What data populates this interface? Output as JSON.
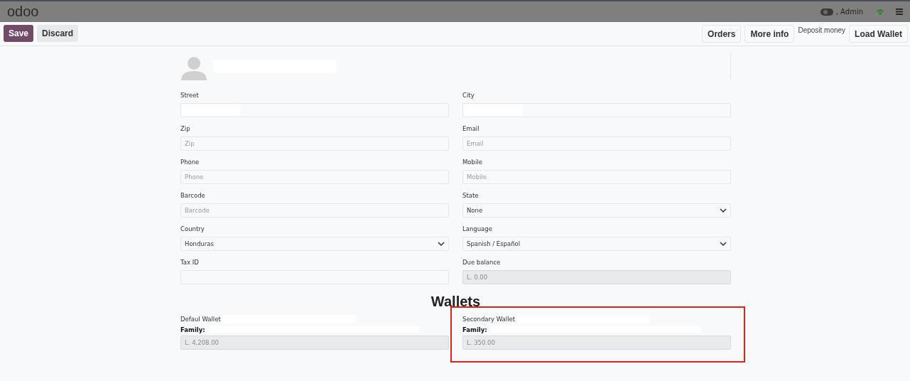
{
  "top_bar": {
    "logo": "odoo",
    "user": ", Admin"
  },
  "toolbar": {
    "left_buttons": [
      {
        "label": "Save",
        "kind": "primary"
      },
      {
        "label": "Discard",
        "kind": "secondary"
      }
    ],
    "right_items": [
      {
        "label": "Orders",
        "kind": "button"
      },
      {
        "label": "More info",
        "kind": "button"
      },
      {
        "label": "Deposit money",
        "kind": "text"
      },
      {
        "label": "Load Wallet",
        "kind": "button"
      }
    ]
  },
  "fields": [
    {
      "label": "Street",
      "kind": "redacted"
    },
    {
      "label": "City",
      "kind": "redacted"
    },
    {
      "label": "Zip",
      "kind": "text",
      "placeholder": "Zip"
    },
    {
      "label": "Email",
      "kind": "text",
      "placeholder": "Email"
    },
    {
      "label": "Phone",
      "kind": "text",
      "placeholder": "Phone"
    },
    {
      "label": "Mobile",
      "kind": "text",
      "placeholder": "Mobile"
    },
    {
      "label": "Barcode",
      "kind": "text",
      "placeholder": "Barcode"
    },
    {
      "label": "State",
      "kind": "select",
      "value": "None"
    },
    {
      "label": "Country",
      "kind": "select",
      "value": "Honduras"
    },
    {
      "label": "Language",
      "kind": "select",
      "value": "Spanish / Español"
    },
    {
      "label": "Tax ID",
      "kind": "text"
    },
    {
      "label": "Due balance",
      "kind": "readonly",
      "value": "L. 0.00"
    }
  ],
  "wallets": {
    "title": "Wallets",
    "items": [
      {
        "name": "Defaul Wallet",
        "family_label": "Family:",
        "balance": "L. 4,208.00",
        "highlighted": false
      },
      {
        "name": "Secondary Wallet",
        "family_label": "Family:",
        "balance": "L. 350.00",
        "highlighted": true
      }
    ]
  }
}
